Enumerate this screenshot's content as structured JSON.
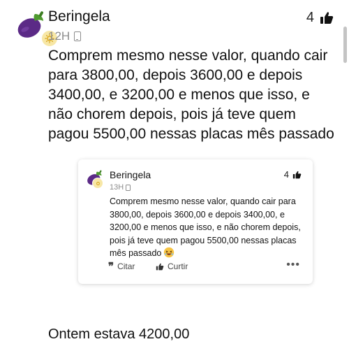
{
  "post": {
    "author": "Beringela",
    "time": "12H",
    "like_count": "4",
    "body": "Comprem mesmo nesse valor, quando cair para 3800,00, depois 3600,00 e depois 3400,00, e 3200,00 e menos que isso, e não chorem depois, pois já teve quem pagou 5500,00 nessas placas mês passado",
    "followup": "Ontem estava 4200,00"
  },
  "quote": {
    "author": "Beringela",
    "time": "13H",
    "like_count": "4",
    "body": "Comprem mesmo nesse valor, quando cair para 3800,00, depois 3600,00 e depois 3400,00, e 3200,00 e menos que isso, e não chorem depois, pois já teve quem pagou 5500,00 nessas placas mês passado",
    "quote_label": "Citar",
    "like_label": "Curtir",
    "more_label": "•••"
  },
  "colors": {
    "avatar_purple": "#5b2a86",
    "avatar_green": "#4f9a2f",
    "meta_gray": "#8c8c8c"
  },
  "icons": [
    "eggplant-avatar",
    "sun-badge-icon",
    "device-icon",
    "thumbs-up-icon",
    "quote-icon",
    "more-icon",
    "laughing-emoji"
  ]
}
